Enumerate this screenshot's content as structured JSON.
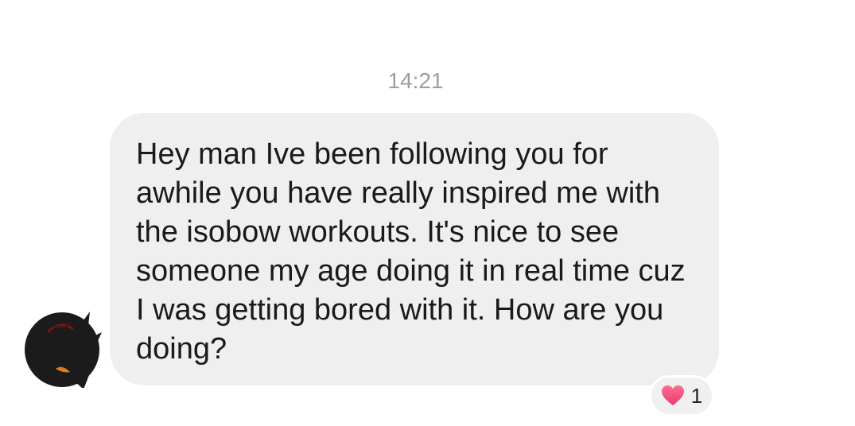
{
  "conversation": {
    "timestamp": "14:21"
  },
  "message": {
    "text": "Hey man Ive been following you for awhile you have really inspired me with the isobow workouts. It's nice to see someone my age doing it in real time cuz I was getting bored with it. How are you doing?",
    "reaction": {
      "icon": "heart-icon",
      "count": "1",
      "color": "#f04f7a"
    }
  },
  "colors": {
    "bubble": "#efefef",
    "timestamp": "#9e9e9e",
    "text": "#1a1a1a"
  }
}
